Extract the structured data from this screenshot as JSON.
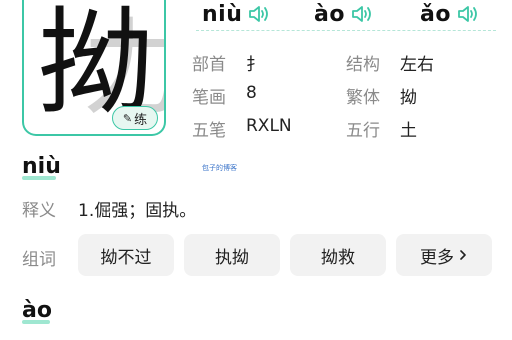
{
  "character": {
    "glyph": "拗",
    "practice_label": "练"
  },
  "pronunciations": [
    {
      "pinyin": "niù"
    },
    {
      "pinyin": "ào"
    },
    {
      "pinyin": "ǎo"
    }
  ],
  "info": {
    "radical_label": "部首",
    "radical_value": "扌",
    "structure_label": "结构",
    "structure_value": "左右",
    "strokes_label": "笔画",
    "strokes_value": "8",
    "traditional_label": "繁体",
    "traditional_value": "拗",
    "wubi_label": "五笔",
    "wubi_value": "RXLN",
    "wuxing_label": "五行",
    "wuxing_value": "土"
  },
  "watermark_text": "包子的博客",
  "section_niu": {
    "pinyin": "niù",
    "meaning_label": "释义",
    "meaning_text": "1.倔强；固执。",
    "words_label": "组词",
    "words": [
      "拗不过",
      "执拗",
      "拗救"
    ],
    "more_label": "更多"
  },
  "section_ao": {
    "pinyin": "ào"
  },
  "colors": {
    "accent": "#3cc7a6",
    "accent_light": "#9fe7d1",
    "label_gray": "#8a8a8a",
    "button_bg": "#f2f2f2"
  },
  "icons": [
    "pencil-icon",
    "speaker-icon",
    "chevron-right-icon"
  ]
}
